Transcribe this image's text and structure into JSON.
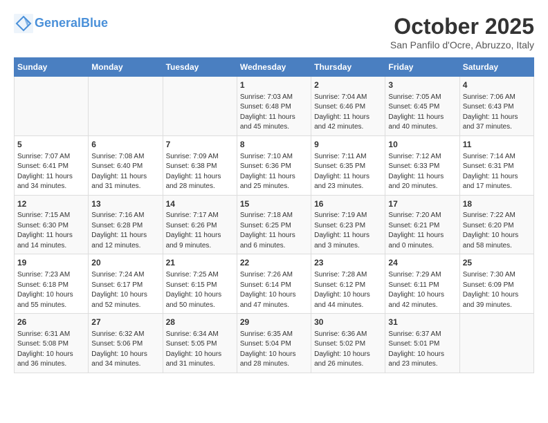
{
  "header": {
    "logo_line1": "General",
    "logo_line2": "Blue",
    "month": "October 2025",
    "location": "San Panfilo d'Ocre, Abruzzo, Italy"
  },
  "weekdays": [
    "Sunday",
    "Monday",
    "Tuesday",
    "Wednesday",
    "Thursday",
    "Friday",
    "Saturday"
  ],
  "weeks": [
    [
      {
        "day": "",
        "info": ""
      },
      {
        "day": "",
        "info": ""
      },
      {
        "day": "",
        "info": ""
      },
      {
        "day": "1",
        "info": "Sunrise: 7:03 AM\nSunset: 6:48 PM\nDaylight: 11 hours\nand 45 minutes."
      },
      {
        "day": "2",
        "info": "Sunrise: 7:04 AM\nSunset: 6:46 PM\nDaylight: 11 hours\nand 42 minutes."
      },
      {
        "day": "3",
        "info": "Sunrise: 7:05 AM\nSunset: 6:45 PM\nDaylight: 11 hours\nand 40 minutes."
      },
      {
        "day": "4",
        "info": "Sunrise: 7:06 AM\nSunset: 6:43 PM\nDaylight: 11 hours\nand 37 minutes."
      }
    ],
    [
      {
        "day": "5",
        "info": "Sunrise: 7:07 AM\nSunset: 6:41 PM\nDaylight: 11 hours\nand 34 minutes."
      },
      {
        "day": "6",
        "info": "Sunrise: 7:08 AM\nSunset: 6:40 PM\nDaylight: 11 hours\nand 31 minutes."
      },
      {
        "day": "7",
        "info": "Sunrise: 7:09 AM\nSunset: 6:38 PM\nDaylight: 11 hours\nand 28 minutes."
      },
      {
        "day": "8",
        "info": "Sunrise: 7:10 AM\nSunset: 6:36 PM\nDaylight: 11 hours\nand 25 minutes."
      },
      {
        "day": "9",
        "info": "Sunrise: 7:11 AM\nSunset: 6:35 PM\nDaylight: 11 hours\nand 23 minutes."
      },
      {
        "day": "10",
        "info": "Sunrise: 7:12 AM\nSunset: 6:33 PM\nDaylight: 11 hours\nand 20 minutes."
      },
      {
        "day": "11",
        "info": "Sunrise: 7:14 AM\nSunset: 6:31 PM\nDaylight: 11 hours\nand 17 minutes."
      }
    ],
    [
      {
        "day": "12",
        "info": "Sunrise: 7:15 AM\nSunset: 6:30 PM\nDaylight: 11 hours\nand 14 minutes."
      },
      {
        "day": "13",
        "info": "Sunrise: 7:16 AM\nSunset: 6:28 PM\nDaylight: 11 hours\nand 12 minutes."
      },
      {
        "day": "14",
        "info": "Sunrise: 7:17 AM\nSunset: 6:26 PM\nDaylight: 11 hours\nand 9 minutes."
      },
      {
        "day": "15",
        "info": "Sunrise: 7:18 AM\nSunset: 6:25 PM\nDaylight: 11 hours\nand 6 minutes."
      },
      {
        "day": "16",
        "info": "Sunrise: 7:19 AM\nSunset: 6:23 PM\nDaylight: 11 hours\nand 3 minutes."
      },
      {
        "day": "17",
        "info": "Sunrise: 7:20 AM\nSunset: 6:21 PM\nDaylight: 11 hours\nand 0 minutes."
      },
      {
        "day": "18",
        "info": "Sunrise: 7:22 AM\nSunset: 6:20 PM\nDaylight: 10 hours\nand 58 minutes."
      }
    ],
    [
      {
        "day": "19",
        "info": "Sunrise: 7:23 AM\nSunset: 6:18 PM\nDaylight: 10 hours\nand 55 minutes."
      },
      {
        "day": "20",
        "info": "Sunrise: 7:24 AM\nSunset: 6:17 PM\nDaylight: 10 hours\nand 52 minutes."
      },
      {
        "day": "21",
        "info": "Sunrise: 7:25 AM\nSunset: 6:15 PM\nDaylight: 10 hours\nand 50 minutes."
      },
      {
        "day": "22",
        "info": "Sunrise: 7:26 AM\nSunset: 6:14 PM\nDaylight: 10 hours\nand 47 minutes."
      },
      {
        "day": "23",
        "info": "Sunrise: 7:28 AM\nSunset: 6:12 PM\nDaylight: 10 hours\nand 44 minutes."
      },
      {
        "day": "24",
        "info": "Sunrise: 7:29 AM\nSunset: 6:11 PM\nDaylight: 10 hours\nand 42 minutes."
      },
      {
        "day": "25",
        "info": "Sunrise: 7:30 AM\nSunset: 6:09 PM\nDaylight: 10 hours\nand 39 minutes."
      }
    ],
    [
      {
        "day": "26",
        "info": "Sunrise: 6:31 AM\nSunset: 5:08 PM\nDaylight: 10 hours\nand 36 minutes."
      },
      {
        "day": "27",
        "info": "Sunrise: 6:32 AM\nSunset: 5:06 PM\nDaylight: 10 hours\nand 34 minutes."
      },
      {
        "day": "28",
        "info": "Sunrise: 6:34 AM\nSunset: 5:05 PM\nDaylight: 10 hours\nand 31 minutes."
      },
      {
        "day": "29",
        "info": "Sunrise: 6:35 AM\nSunset: 5:04 PM\nDaylight: 10 hours\nand 28 minutes."
      },
      {
        "day": "30",
        "info": "Sunrise: 6:36 AM\nSunset: 5:02 PM\nDaylight: 10 hours\nand 26 minutes."
      },
      {
        "day": "31",
        "info": "Sunrise: 6:37 AM\nSunset: 5:01 PM\nDaylight: 10 hours\nand 23 minutes."
      },
      {
        "day": "",
        "info": ""
      }
    ]
  ]
}
